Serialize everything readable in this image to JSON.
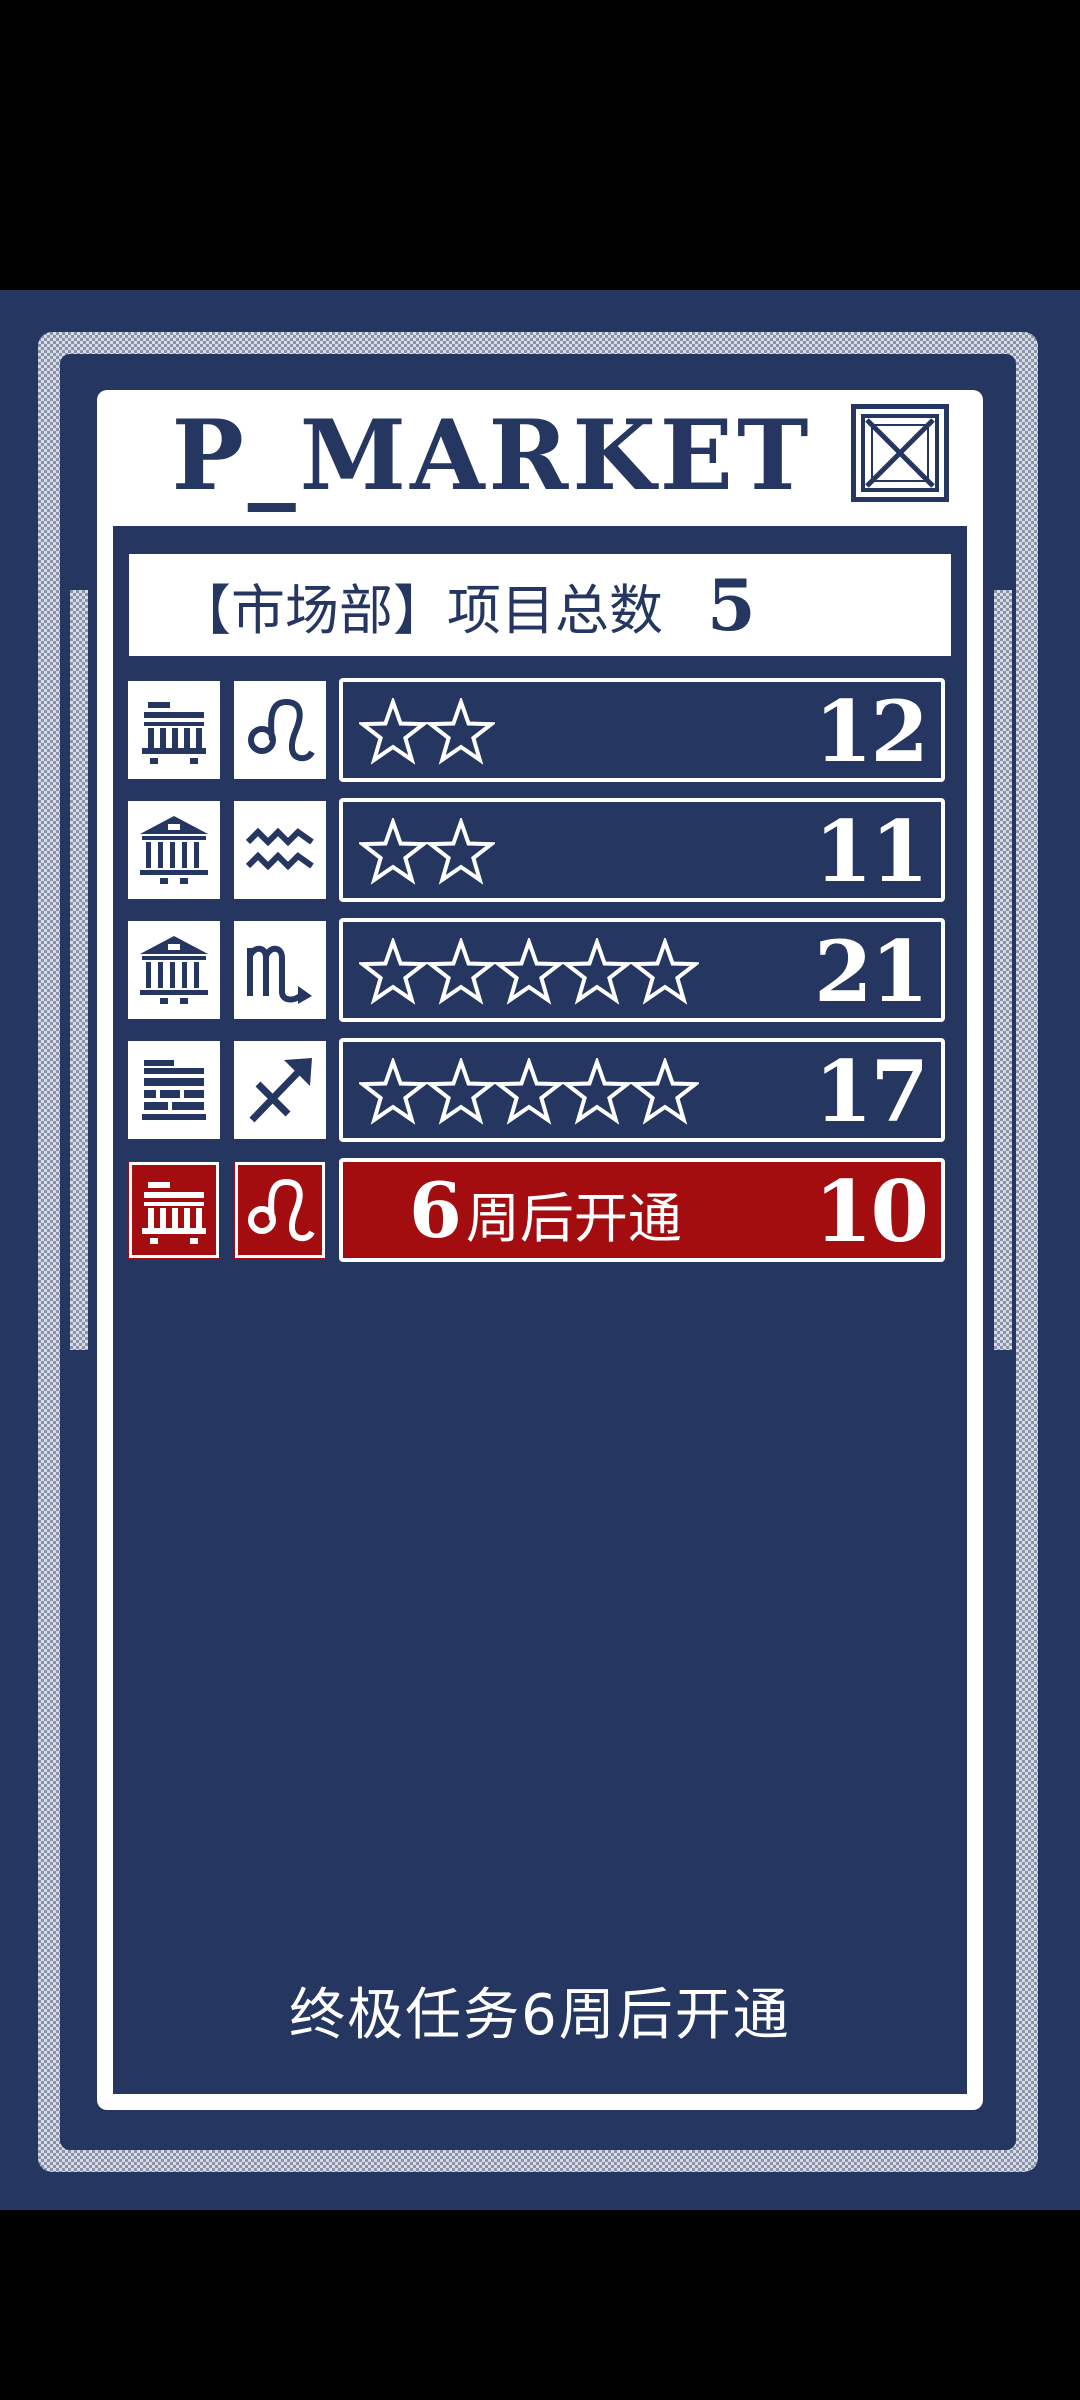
{
  "screen": {
    "title": "P_MARKET",
    "close_icon": "close-x-box-icon"
  },
  "summary": {
    "label": "【市场部】项目总数",
    "count": "5"
  },
  "projects": [
    {
      "building_icon": "factory-icon",
      "sign_icon": "leo-icon",
      "stars": 2,
      "value": "12",
      "locked": false
    },
    {
      "building_icon": "bank-icon",
      "sign_icon": "aquarius-icon",
      "stars": 2,
      "value": "11",
      "locked": false
    },
    {
      "building_icon": "bank-icon",
      "sign_icon": "scorpio-icon",
      "stars": 5,
      "value": "21",
      "locked": false
    },
    {
      "building_icon": "warehouse-icon",
      "sign_icon": "sagittarius-icon",
      "stars": 5,
      "value": "17",
      "locked": false
    },
    {
      "building_icon": "factory-icon",
      "sign_icon": "leo-icon",
      "stars": 0,
      "value": "10",
      "locked": true,
      "unlock_weeks": "6",
      "unlock_text": "周后开通"
    }
  ],
  "footer": {
    "note": "终极任务6周后开通"
  },
  "colors": {
    "background": "#253760",
    "panel": "#ffffff",
    "locked": "#a30d10",
    "screen_border": "#000000"
  }
}
